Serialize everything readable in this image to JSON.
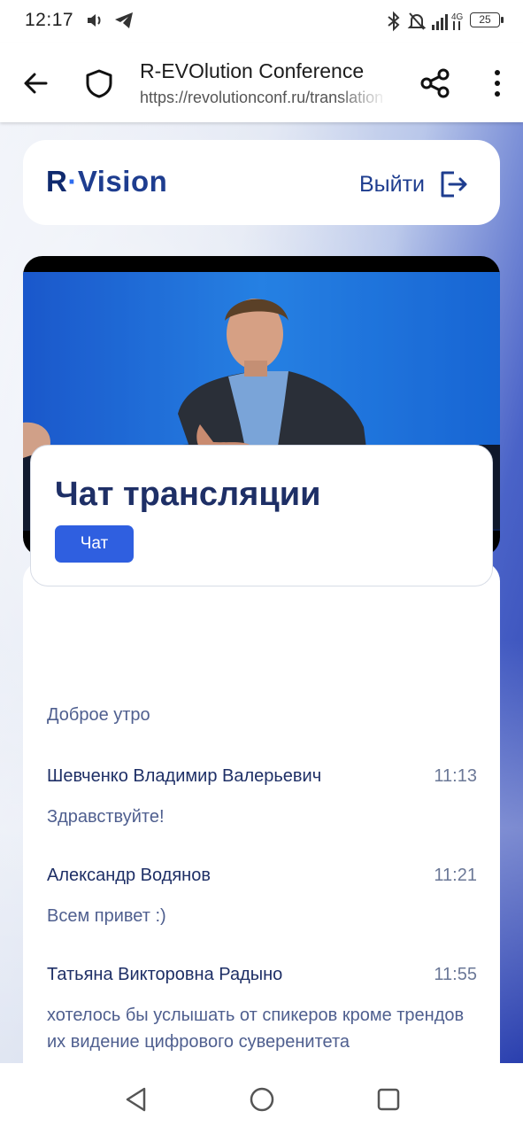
{
  "status_bar": {
    "time": "12:17",
    "network": "4G",
    "battery": "25",
    "icons": [
      "volume-icon",
      "telegram-icon",
      "bluetooth-icon",
      "notifications-off-icon",
      "signal-icon",
      "battery-icon"
    ]
  },
  "browser": {
    "title": "R-EVOlution Conference",
    "url": "https://revolutionconf.ru/translation",
    "icons": [
      "back-arrow-icon",
      "shield-icon",
      "share-icon",
      "more-vert-icon"
    ]
  },
  "header": {
    "logo_r": "R",
    "logo_dot": "·",
    "logo_vision": "Vision",
    "logout_label": "Выйти"
  },
  "chat": {
    "title": "Чат трансляции",
    "tab_label": "Чат",
    "partial_message": "Доброе утро",
    "messages": [
      {
        "author": "Шевченко Владимир Валерьевич",
        "time": "11:13",
        "text": "Здравствуйте!"
      },
      {
        "author": "Александр Водянов",
        "time": "11:21",
        "text": "Всем привет :)"
      },
      {
        "author": "Татьяна Викторовна Радыно",
        "time": "11:55",
        "text": "хотелось бы услышать от спикеров кроме трендов их видение цифрового суверенитета"
      }
    ]
  },
  "colors": {
    "accent": "#2f5fe0",
    "brand_dark": "#1e3d8f",
    "chat_text": "#4f5f8f"
  }
}
